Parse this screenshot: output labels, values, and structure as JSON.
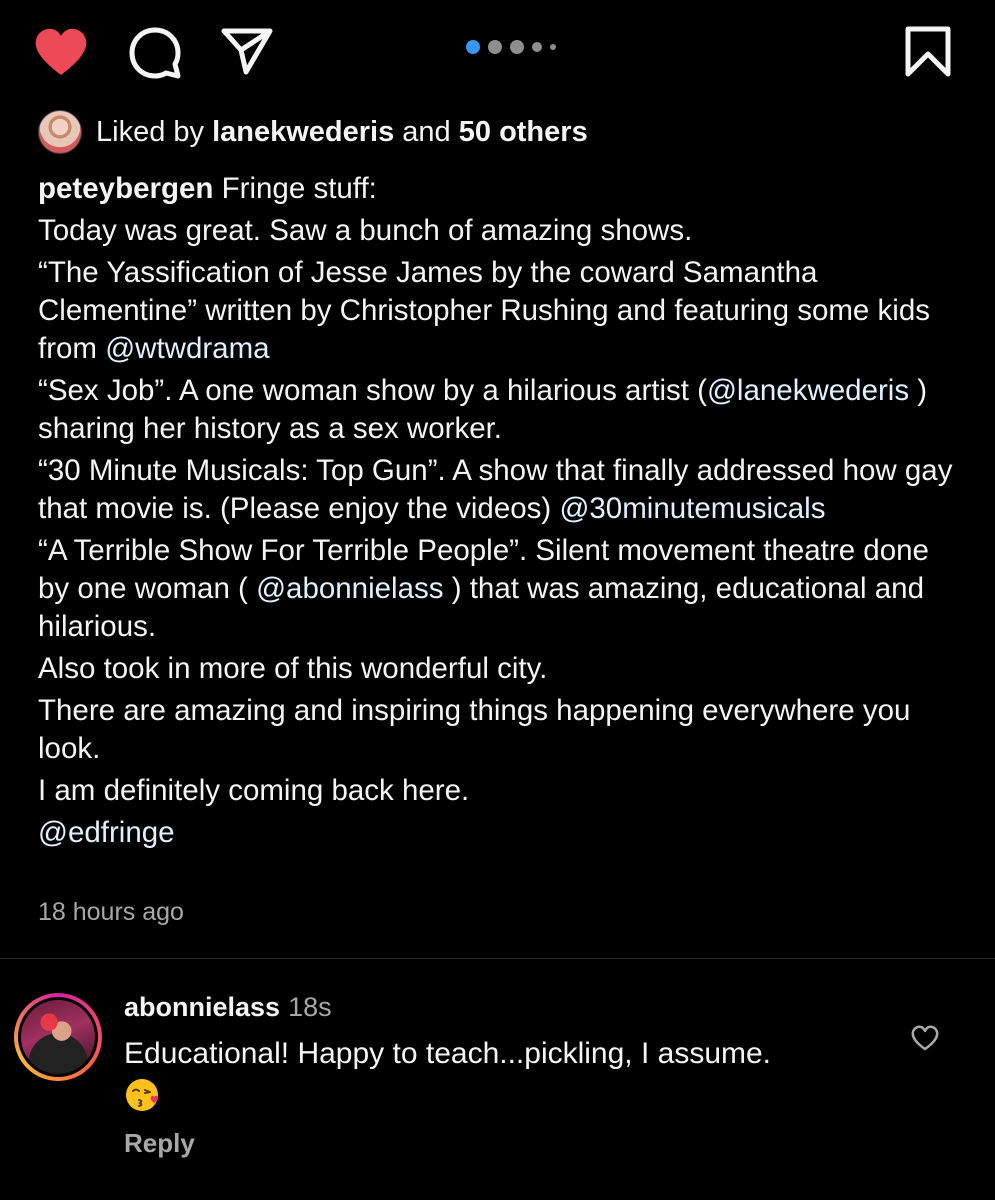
{
  "actions": {
    "like_icon": "heart-filled-icon",
    "comment_icon": "comment-bubble-icon",
    "share_icon": "paper-plane-icon",
    "save_icon": "bookmark-icon",
    "like_color": "#ed4956",
    "carousel_active_color": "#3897f0",
    "carousel_count": 5,
    "carousel_active_index": 0
  },
  "likes": {
    "prefix": "Liked by",
    "liker": "lanekwederis",
    "connector": "and",
    "others": "50 others"
  },
  "caption": {
    "username": "peteybergen",
    "title": "Fringe stuff:",
    "line1": "Today was great. Saw a bunch of amazing shows.",
    "line2_text": "“The Yassification of Jesse James by the coward Samantha Clementine” written by Christopher Rushing and featuring some kids from",
    "line2_mention": "@wtwdrama",
    "line3_text_a": "“Sex Job”. A one woman show by a hilarious artist (",
    "line3_mention": "@lanekwederis",
    "line3_text_b": " ) sharing her history as a sex worker.",
    "line4_text": "“30 Minute Musicals: Top Gun”. A show that finally addressed how gay that movie is. (Please enjoy the videos)",
    "line4_mention": "@30minutemusicals",
    "line5_text_a": "“A Terrible Show For Terrible People”. Silent movement theatre done by one woman (",
    "line5_mention": "@abonnielass",
    "line5_text_b": " ) that was amazing, educational and hilarious.",
    "line6": "Also took in more of this wonderful city.",
    "line7": "There are amazing and inspiring things happening everywhere you look.",
    "line8": "I am definitely coming back here.",
    "line9_mention": "@edfringe"
  },
  "timestamp": "18 hours ago",
  "comment": {
    "username": "abonnielass",
    "time": "18s",
    "text": "Educational! Happy to teach...pickling, I assume.",
    "emoji": "kissing-face-with-heart-emoji",
    "reply_label": "Reply",
    "like_icon": "heart-outline-icon"
  }
}
